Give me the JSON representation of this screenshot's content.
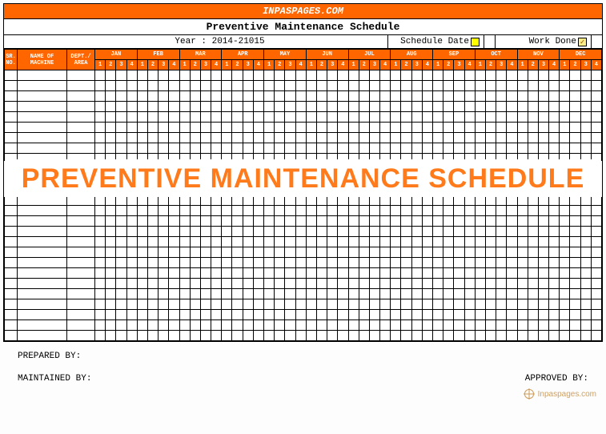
{
  "brand": "INPASPAGES.COM",
  "title": "Preventive Maintenance Schedule",
  "year_label": "Year : 2014-21015",
  "schedule_date_label": "Schedule Date",
  "work_done_label": "Work Done",
  "work_done_mark": "✓",
  "headers": {
    "sr": "SR. NO.",
    "name": "NAME OF MACHINE",
    "dept": "DEPT./ AREA"
  },
  "months": [
    "JAN",
    "FEB",
    "MAR",
    "APR",
    "MAY",
    "JUN",
    "JUL",
    "AUG",
    "SEP",
    "OCT",
    "NOV",
    "DEC"
  ],
  "weeks": [
    "1",
    "2",
    "3",
    "4"
  ],
  "row_count": 26,
  "watermark": "PREVENTIVE MAINTENANCE SCHEDULE",
  "footer": {
    "prepared": "PREPARED BY:",
    "maintained": "MAINTAINED BY:",
    "approved": "APPROVED BY:"
  },
  "corner_brand": "Inpaspages.com"
}
